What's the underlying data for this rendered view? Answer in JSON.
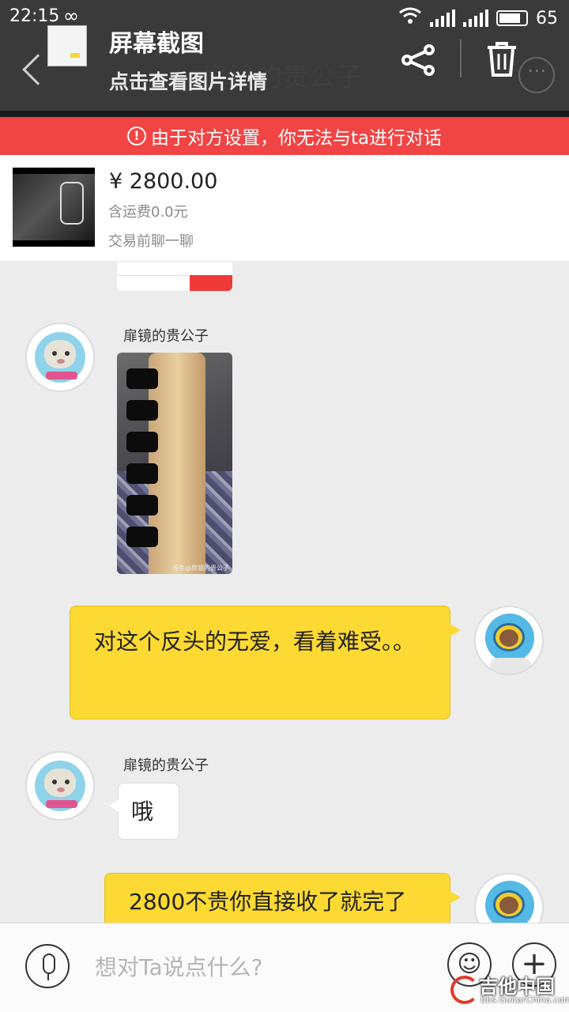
{
  "status_bar": {
    "time": "22:15",
    "infinity": "∞",
    "battery": "65"
  },
  "header": {
    "chat_title": "扉镜的贵公子",
    "notification_title": "屏幕截图",
    "notification_subtitle": "点击查看图片详情",
    "icons": [
      "back-icon",
      "share-icon",
      "trash-icon",
      "more-icon"
    ]
  },
  "warning": {
    "text": "由于对方设置，你无法与ta进行对话",
    "icon": "!"
  },
  "product": {
    "price": "¥ 2800.00",
    "shipping": "含运费0.0元",
    "chat_first": "交易前聊一聊"
  },
  "messages": [
    {
      "side": "left",
      "sender": "扉镜的贵公子",
      "type": "image",
      "watermark": "闲鱼@扉镜的贵公子"
    },
    {
      "side": "right",
      "type": "text",
      "text": "对这个反头的无爱，看着难受。。"
    },
    {
      "side": "left",
      "sender": "扉镜的贵公子",
      "type": "text",
      "text": "哦"
    },
    {
      "side": "right",
      "type": "text",
      "text": "2800不贵你直接收了就完了"
    }
  ],
  "input": {
    "placeholder": "想对Ta说点什么?"
  },
  "watermark_logo": {
    "main": "吉他中国",
    "sub": "bbs.GuitarChina.com"
  },
  "colors": {
    "warning_red": "#f14444",
    "bubble_yellow": "#fcd933",
    "header_dark": "#3a3a3a"
  }
}
